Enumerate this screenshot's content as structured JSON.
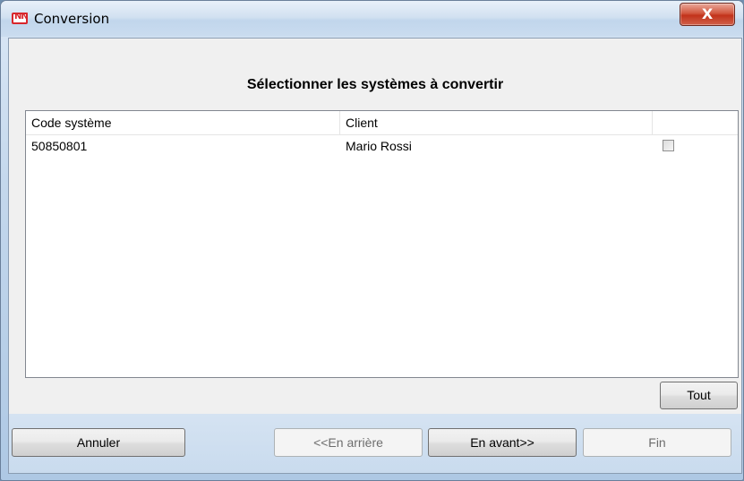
{
  "window": {
    "title": "Conversion",
    "close_glyph": "X",
    "app_icon_glyph": "NN",
    "app_icon_color": "#d8262c"
  },
  "header": {
    "heading": "Sélectionner les systèmes à convertir"
  },
  "list": {
    "columns": [
      "Code système",
      "Client",
      ""
    ],
    "rows": [
      {
        "code": "50850801",
        "client": "Mario Rossi",
        "checked": false
      }
    ]
  },
  "buttons": {
    "select_all": "Tout",
    "cancel": "Annuler",
    "back": "<<En arrière",
    "next": "En avant>>",
    "finish": "Fin"
  },
  "colors": {
    "close_button": "#c2331b",
    "footer": "#c9dbee",
    "panel": "#f0f0f0"
  }
}
